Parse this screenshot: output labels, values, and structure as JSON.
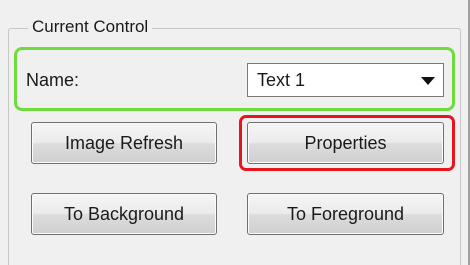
{
  "group": {
    "title": "Current Control"
  },
  "name_row": {
    "label": "Name:",
    "selected_value": "Text 1",
    "dropdown_icon": "chevron-down-icon"
  },
  "buttons": {
    "image_refresh": "Image Refresh",
    "properties": "Properties",
    "to_background": "To Background",
    "to_foreground": "To Foreground"
  },
  "annotations": {
    "name_row_outline_color": "#6edc3c",
    "properties_outline_color": "#e8141f"
  },
  "colors": {
    "panel_background": "#f0f0f0",
    "button_border": "#707070"
  }
}
